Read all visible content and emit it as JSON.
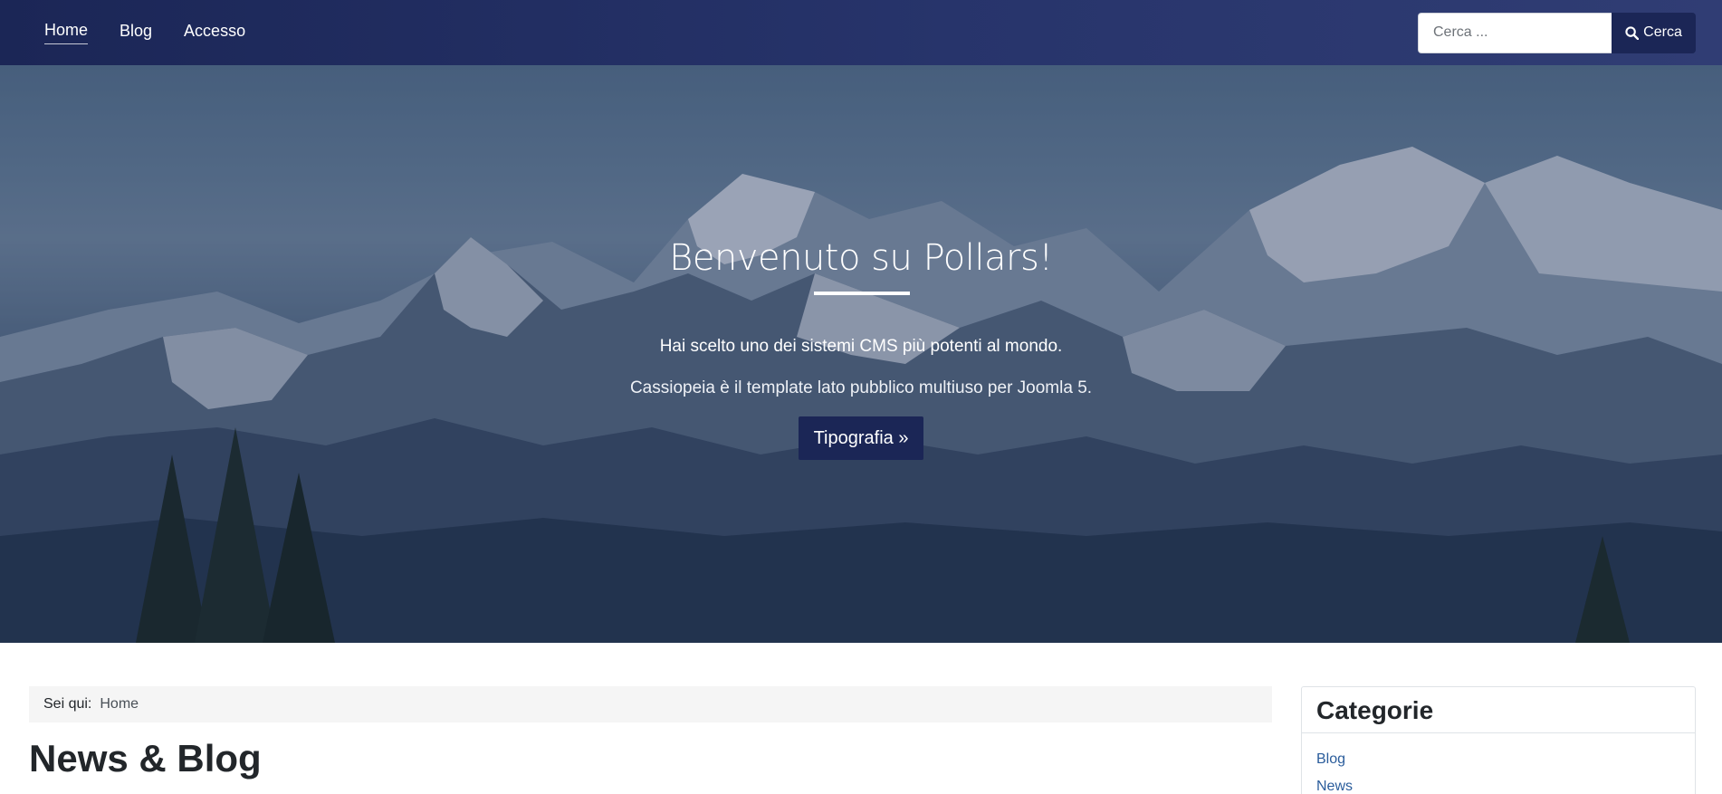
{
  "nav": {
    "items": [
      {
        "label": "Home",
        "active": true
      },
      {
        "label": "Blog",
        "active": false
      },
      {
        "label": "Accesso",
        "active": false
      }
    ]
  },
  "search": {
    "placeholder": "Cerca ...",
    "button_label": "Cerca",
    "icon": "search-icon"
  },
  "hero": {
    "title": "Benvenuto su Pollars!",
    "subtitle": "Hai scelto uno dei sistemi CMS più potenti al mondo.",
    "description": "Cassiopeia è il template lato pubblico multiuso per Joomla 5.",
    "button_label": "Tipografia »"
  },
  "breadcrumb": {
    "label": "Sei qui:",
    "items": [
      "Home"
    ]
  },
  "main": {
    "title": "News & Blog"
  },
  "sidebar": {
    "title": "Categorie",
    "items": [
      "Blog",
      "News"
    ]
  },
  "colors": {
    "header": "#1b2656",
    "button": "#1b2656",
    "link": "#2a5c9b"
  }
}
